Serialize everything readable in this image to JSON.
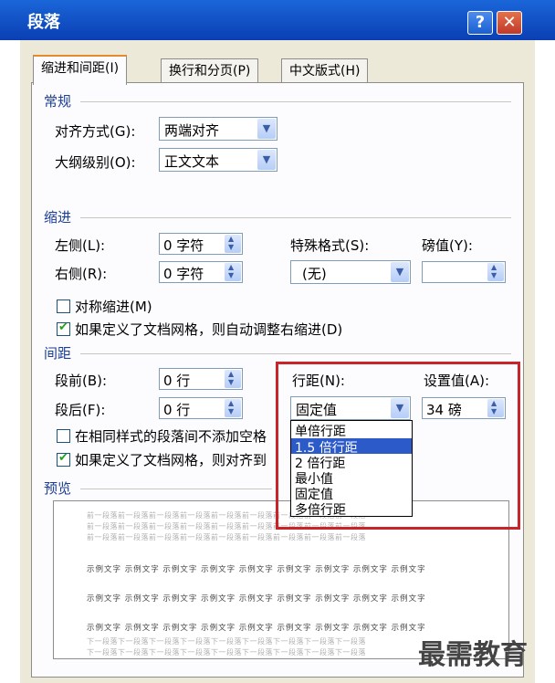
{
  "window": {
    "title": "段落",
    "help_glyph": "?",
    "close_glyph": "✕"
  },
  "tabs": [
    {
      "label": "缩进和间距(I)",
      "active": true
    },
    {
      "label": "换行和分页(P)",
      "active": false
    },
    {
      "label": "中文版式(H)",
      "active": false
    }
  ],
  "general": {
    "heading": "常规",
    "alignment": {
      "label": "对齐方式(G):",
      "value": "两端对齐"
    },
    "outline": {
      "label": "大纲级别(O):",
      "value": "正文文本"
    }
  },
  "indent": {
    "heading": "缩进",
    "left": {
      "label": "左侧(L):",
      "value": "0 字符"
    },
    "right": {
      "label": "右侧(R):",
      "value": "0 字符"
    },
    "special": {
      "label": "特殊格式(S):",
      "value": "(无)"
    },
    "by": {
      "label": "磅值(Y):",
      "value": ""
    },
    "mirror": {
      "label": "对称缩进(M)",
      "checked": false
    },
    "auto_adjust": {
      "label": "如果定义了文档网格，则自动调整右缩进(D)",
      "checked": true
    }
  },
  "spacing": {
    "heading": "间距",
    "before": {
      "label": "段前(B):",
      "value": "0 行"
    },
    "after": {
      "label": "段后(F):",
      "value": "0 行"
    },
    "line_spacing": {
      "label": "行距(N):",
      "value": "固定值"
    },
    "at": {
      "label": "设置值(A):",
      "value": "34 磅"
    },
    "no_space_same_style": {
      "label": "在相同样式的段落间不添加空格",
      "checked": false
    },
    "snap_grid": {
      "label": "如果定义了文档网格，则对齐到",
      "checked": true
    }
  },
  "line_spacing_options": [
    "单倍行距",
    "1.5 倍行距",
    "2 倍行距",
    "最小值",
    "固定值",
    "多倍行距"
  ],
  "line_spacing_highlighted": "1.5 倍行距",
  "preview": {
    "heading": "预览",
    "prev_para": "前一段落前一段落前一段落前一段落前一段落前一段落前一段落前一段落前一段落",
    "sample": "示例文字 示例文字 示例文字 示例文字 示例文字 示例文字 示例文字 示例文字 示例文字",
    "next_para": "下一段落下一段落下一段落下一段落下一段落下一段落下一段落下一段落下一段落"
  },
  "watermark": "最需教育",
  "colors": {
    "highlight": "#c8252b",
    "selection": "#2c5ac9",
    "section_heading": "#1c3e94"
  }
}
